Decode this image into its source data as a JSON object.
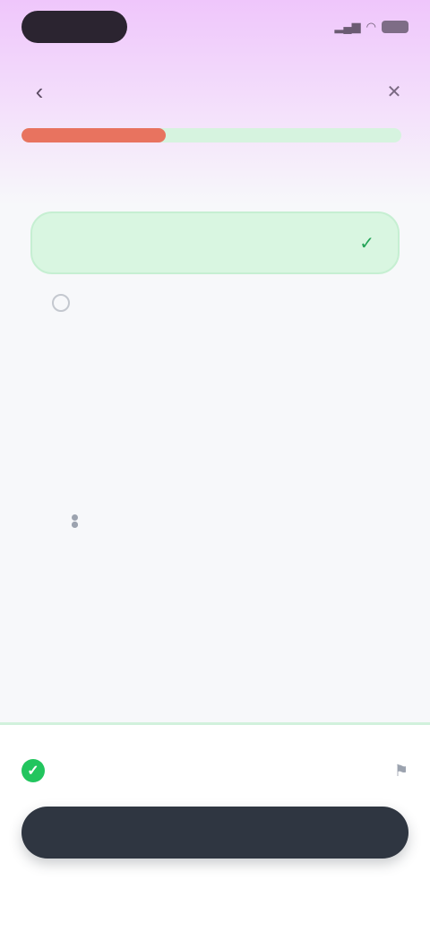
{
  "status_bar": {
    "time": "",
    "icons": [
      "signal-icon",
      "wifi-icon",
      "battery-icon"
    ]
  },
  "header": {
    "title": "",
    "back_icon": "chevron-left-icon",
    "close_icon": "close-icon"
  },
  "progress": {
    "value_percent": 38,
    "fill_color": "#e8735f",
    "track_color": "#d6f3df"
  },
  "question": {
    "text": ""
  },
  "answer": {
    "text": "",
    "state": "correct",
    "icon": "check-icon",
    "bg_color": "#d9f6e1"
  },
  "other_option": {
    "text": ""
  },
  "explanation": {
    "divider_label": "",
    "section_title": "",
    "bullets": [
      "",
      "",
      ""
    ],
    "footnote": ""
  },
  "result": {
    "badge_icon": "check-icon",
    "text": "",
    "flag_icon": "flag-icon",
    "color": "#22c55e"
  },
  "continue_button": {
    "label": "",
    "bg_color": "#2f3641"
  }
}
